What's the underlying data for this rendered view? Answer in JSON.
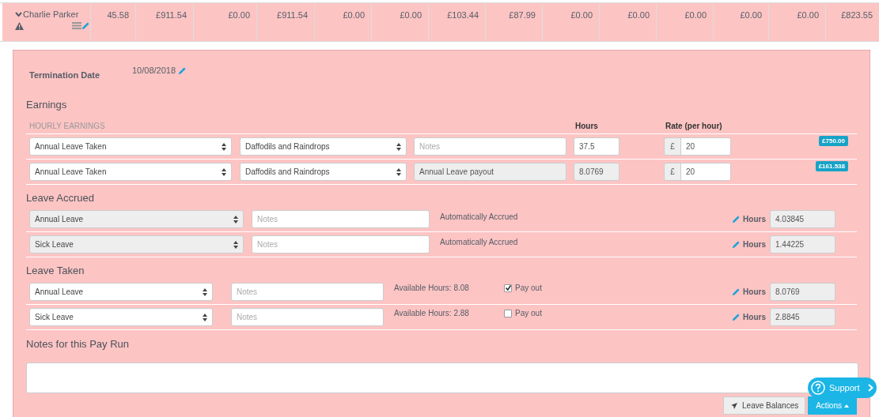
{
  "employee_row": {
    "name": "Charlie Parker",
    "expanded": true,
    "warning": true,
    "cells": [
      "45.58",
      "£911.54",
      "£0.00",
      "£911.54",
      "£0.00",
      "£0.00",
      "£103.44",
      "£87.99",
      "£0.00",
      "£0.00",
      "£0.00",
      "£0.00",
      "£0.00",
      "£823.55"
    ]
  },
  "termination": {
    "label": "Termination Date",
    "value": "10/08/2018"
  },
  "earnings": {
    "title": "Earnings",
    "section_label": "HOURLY EARNINGS",
    "hours_heading": "Hours",
    "rate_heading": "Rate (per hour)",
    "rows": [
      {
        "category": "Annual Leave Taken",
        "location": "Daffodils and Raindrops",
        "notes_placeholder": "Notes",
        "notes_value": "",
        "notes_disabled": false,
        "hours": "37.5",
        "hours_disabled": false,
        "currency": "£",
        "rate": "20",
        "amount": "£750.00"
      },
      {
        "category": "Annual Leave Taken",
        "location": "Daffodils and Raindrops",
        "notes_placeholder": "",
        "notes_value": "Annual Leave payout",
        "notes_disabled": true,
        "hours": "8.0769",
        "hours_disabled": true,
        "currency": "£",
        "rate": "20",
        "amount": "£161.538"
      }
    ]
  },
  "leave_accrued": {
    "title": "Leave Accrued",
    "rows": [
      {
        "leave_type": "Annual Leave",
        "select_disabled": true,
        "notes_placeholder": "Notes",
        "status": "Automatically Accrued",
        "hours_label": "Hours",
        "hours": "4.03845"
      },
      {
        "leave_type": "Sick Leave",
        "select_disabled": true,
        "notes_placeholder": "Notes",
        "status": "Automatically Accrued",
        "hours_label": "Hours",
        "hours": "1.44225"
      }
    ]
  },
  "leave_taken": {
    "title": "Leave Taken",
    "rows": [
      {
        "leave_type": "Annual Leave",
        "select_disabled": false,
        "notes_placeholder": "Notes",
        "available": "Available Hours: 8.08",
        "payout_label": "Pay out",
        "checked": true,
        "hours_label": "Hours",
        "hours": "8.0769"
      },
      {
        "leave_type": "Sick Leave",
        "select_disabled": false,
        "notes_placeholder": "Notes",
        "available": "Available Hours: 2.88",
        "payout_label": "Pay out",
        "checked": false,
        "hours_label": "Hours",
        "hours": "2.8845"
      }
    ]
  },
  "pay_run_notes": {
    "title": "Notes for this Pay Run"
  },
  "buttons": {
    "leave_balances": "Leave Balances",
    "actions": "Actions"
  },
  "support": {
    "label": "Support"
  }
}
